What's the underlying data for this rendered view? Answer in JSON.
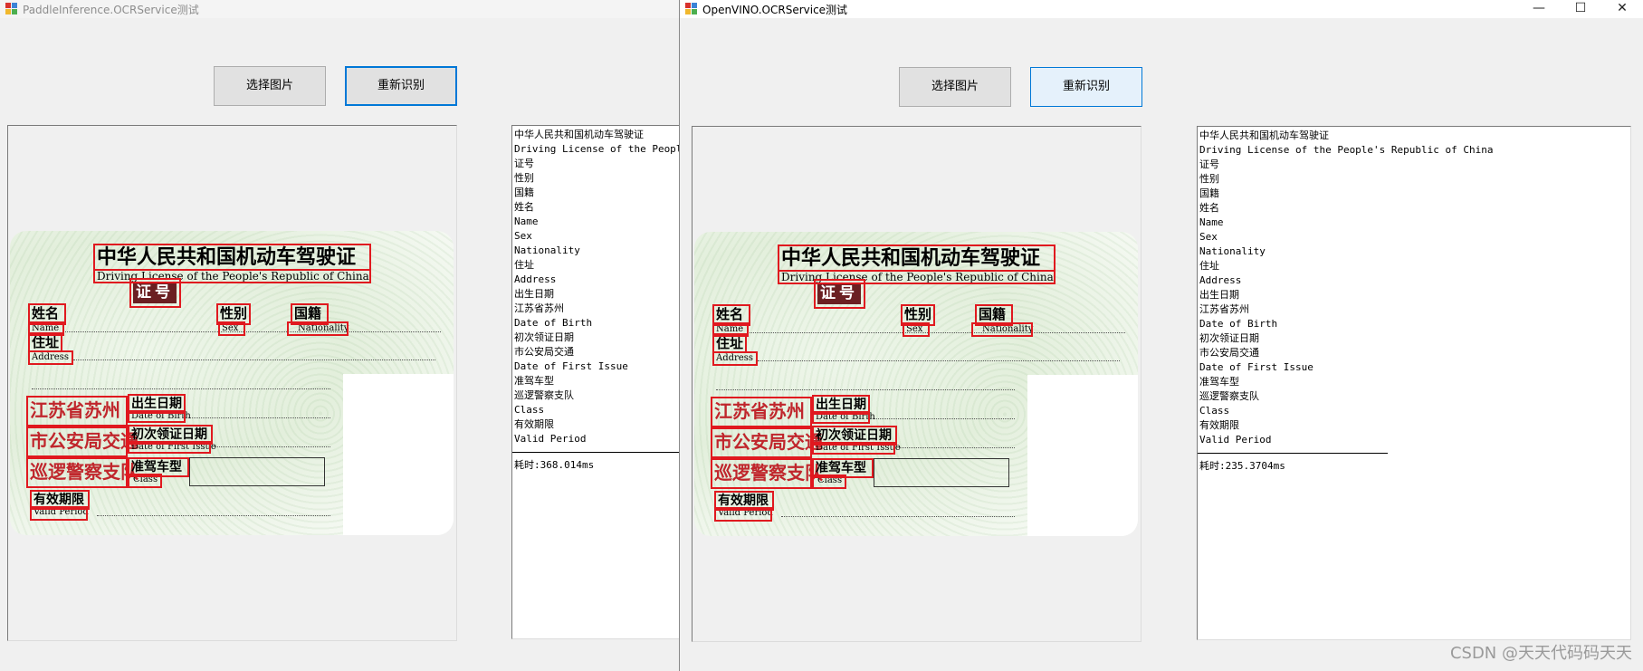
{
  "windows": [
    {
      "title": "PaddleInference.OCRService测试",
      "buttons": {
        "select_image": "选择图片",
        "recognize": "重新识别"
      },
      "result_lines": [
        "中华人民共和国机动车驾驶证",
        "Driving License of the People's Republic of China",
        "证号",
        "性别",
        "国籍",
        "姓名",
        "Name",
        "Sex",
        "Nationality",
        "住址",
        "Address",
        "出生日期",
        "江苏省苏州",
        "Date of Birth",
        "初次领证日期",
        "市公安局交通",
        "Date of First Issue",
        "准驾车型",
        "巡逻警察支队",
        "Class",
        "有效期限",
        "Valid Period"
      ],
      "elapsed": "耗时:368.014ms"
    },
    {
      "title": "OpenVINO.OCRService测试",
      "caption_buttons": {
        "minimize": "—",
        "maximize": "☐",
        "close": "✕"
      },
      "buttons": {
        "select_image": "选择图片",
        "recognize": "重新识别"
      },
      "result_lines": [
        "中华人民共和国机动车驾驶证",
        "Driving License of the People's Republic of China",
        "证号",
        "性别",
        "国籍",
        "姓名",
        "Name",
        "Sex",
        "Nationality",
        "住址",
        "Address",
        "出生日期",
        "江苏省苏州",
        "Date of Birth",
        "初次领证日期",
        "市公安局交通",
        "Date of First Issue",
        "准驾车型",
        "巡逻警察支队",
        "Class",
        "有效期限",
        "Valid Period"
      ],
      "elapsed": "耗时:235.3704ms"
    }
  ],
  "card": {
    "title_cn": "中华人民共和国机动车驾驶证",
    "title_en": "Driving License of the People's Republic of China",
    "license_no": "证号",
    "name_cn": "姓名",
    "name_en": "Name",
    "sex_cn": "性别",
    "sex_en": "Sex",
    "nat_cn": "国籍",
    "nat_en": "Nationality",
    "addr_cn": "住址",
    "addr_en": "Address",
    "stamp_line1": "江苏省苏州",
    "stamp_line2": "市公安局交通",
    "stamp_line3": "巡逻警察支队",
    "dob_cn": "出生日期",
    "dob_en": "Date of Birth",
    "first_cn": "初次领证日期",
    "first_en": "Date of First Issue",
    "class_cn": "准驾车型",
    "class_en": "Class",
    "valid_cn": "有效期限",
    "valid_en": "Valid Period"
  },
  "watermark": "CSDN @天天代码码天天",
  "colors": {
    "detection_box": "#e0191f",
    "button_focus": "#0078d7",
    "stamp_text": "#c0262c"
  }
}
